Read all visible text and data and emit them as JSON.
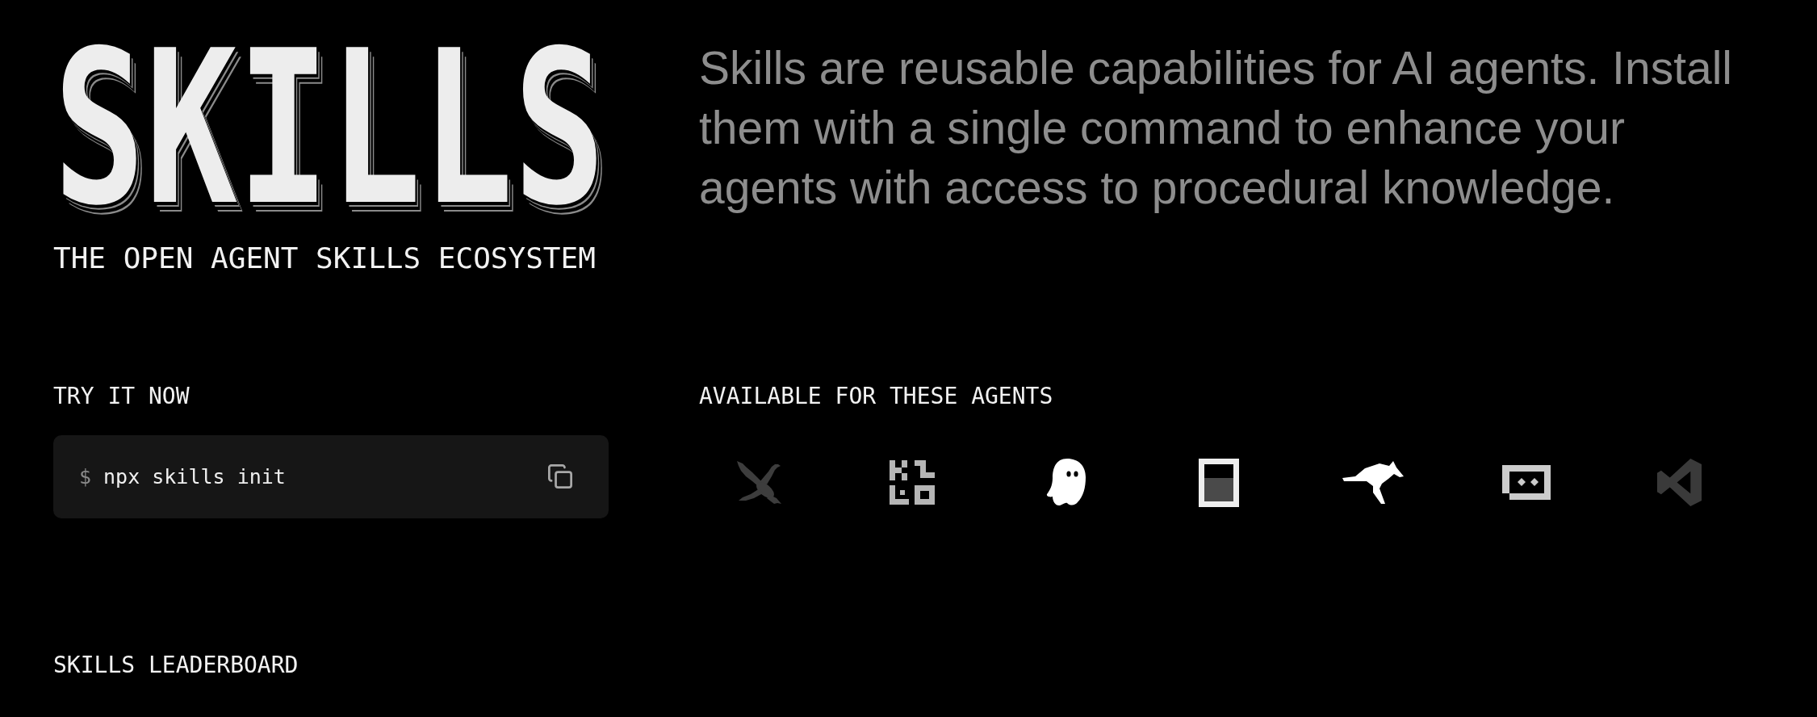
{
  "logo": {
    "title": "SKILLS",
    "tagline": "THE OPEN AGENT SKILLS ECOSYSTEM"
  },
  "intro": "Skills are reusable capabilities for AI agents. Install them with a single command to enhance your agents with access to procedural knowledge.",
  "try_it": {
    "heading": "TRY IT NOW",
    "prompt": "$",
    "command": "npx skills init"
  },
  "agents": {
    "heading": "AVAILABLE FOR THESE AGENTS"
  },
  "leaderboard": {
    "heading": "SKILLS LEADERBOARD"
  }
}
